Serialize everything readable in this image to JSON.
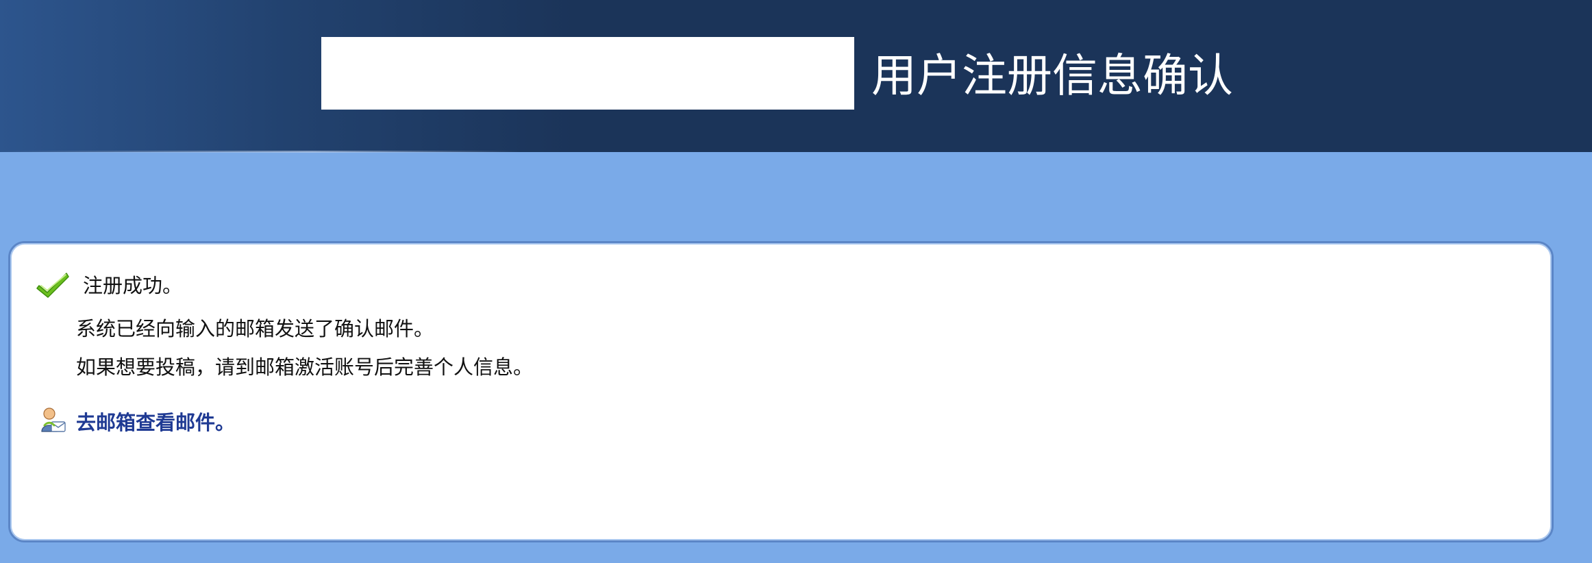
{
  "header": {
    "title": "用户注册信息确认"
  },
  "message": {
    "success": "注册成功。",
    "line_email_sent": "系统已经向输入的邮箱发送了确认邮件。",
    "line_instruction": "如果想要投稿，请到邮箱激活账号后完善个人信息。"
  },
  "actions": {
    "check_mail": "去邮箱查看邮件。"
  },
  "icons": {
    "success": "check-icon",
    "mail": "user-mail-icon"
  },
  "colors": {
    "header_bg": "#1b3459",
    "page_bg": "#7aaae8",
    "panel_border": "#5b86c7",
    "link": "#1f3a93",
    "check_green": "#6bbf1f"
  }
}
